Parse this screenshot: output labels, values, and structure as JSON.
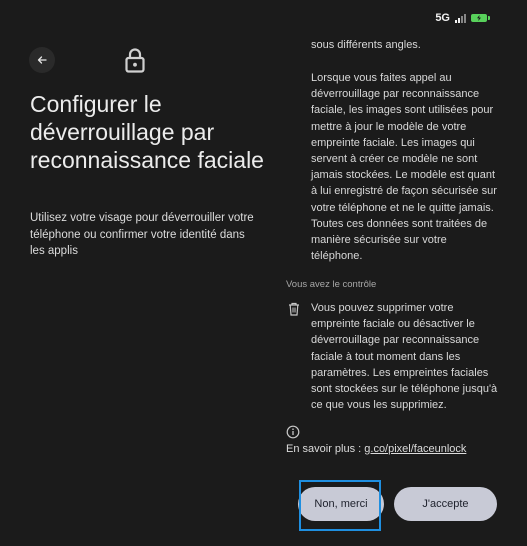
{
  "status_bar": {
    "network": "5G",
    "battery_level_fraction": 0.85,
    "battery_color": "#58d15b"
  },
  "header": {
    "back_icon": "arrow-left-icon",
    "lock_icon": "lock-icon",
    "title": "Configurer le déverrouillage par reconnaissance faciale",
    "subtitle": "Utilisez votre visage pour déverrouiller votre téléphone ou confirmer votre identité dans les applis"
  },
  "content": {
    "para_top": "sous différents angles.",
    "para_main": "Lorsque vous faites appel au déverrouillage par reconnaissance faciale, les images sont utilisées pour mettre à jour le modèle de votre empreinte faciale. Les images qui servent à créer ce modèle ne sont jamais stockées. Le modèle est quant à lui enregistré de façon sécurisée sur votre téléphone et ne le quitte jamais. Toutes ces données sont traitées de manière sécurisée sur votre téléphone.",
    "section_label": "Vous avez le contrôle",
    "control_icon": "trash-icon",
    "control_text": "Vous pouvez supprimer votre empreinte faciale ou désactiver le déverrouillage par reconnaissance faciale à tout moment dans les paramètres. Les empreintes faciales sont stockées sur le téléphone jusqu'à ce que vous les supprimiez.",
    "info_icon": "info-icon",
    "learn_more_prefix": "En savoir plus :",
    "learn_more_link": "g.co/pixel/faceunlock"
  },
  "actions": {
    "decline_label": "Non, merci",
    "accept_label": "J'accepte",
    "highlight_color": "#1f8fe0"
  }
}
